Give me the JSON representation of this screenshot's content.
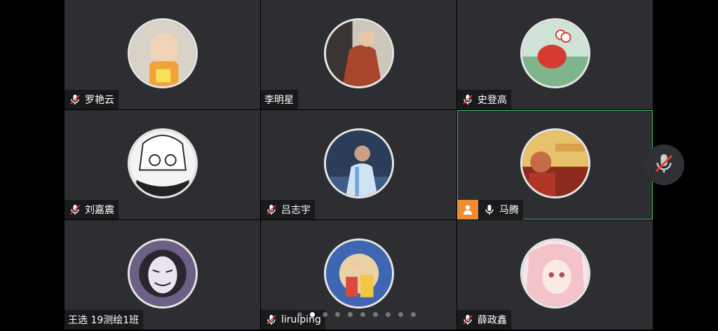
{
  "participants": [
    {
      "name": "罗艳云",
      "muted": true
    },
    {
      "name": "李明星",
      "muted": false
    },
    {
      "name": "史登高",
      "muted": true
    },
    {
      "name": "刘嘉震",
      "muted": true
    },
    {
      "name": "吕志宇",
      "muted": true
    },
    {
      "name": "马腾",
      "muted": false,
      "host": true,
      "speaking": true
    },
    {
      "name": "王选 19测绘1班",
      "muted": false
    },
    {
      "name": "liruiping",
      "muted": true
    },
    {
      "name": "薛政鑫",
      "muted": true
    }
  ],
  "pagination": {
    "page_count": 10,
    "current_page": 2
  },
  "colors": {
    "active_border": "#3dba6e",
    "host_badge": "#f08a33",
    "muted_icon": "#e23c3c"
  }
}
